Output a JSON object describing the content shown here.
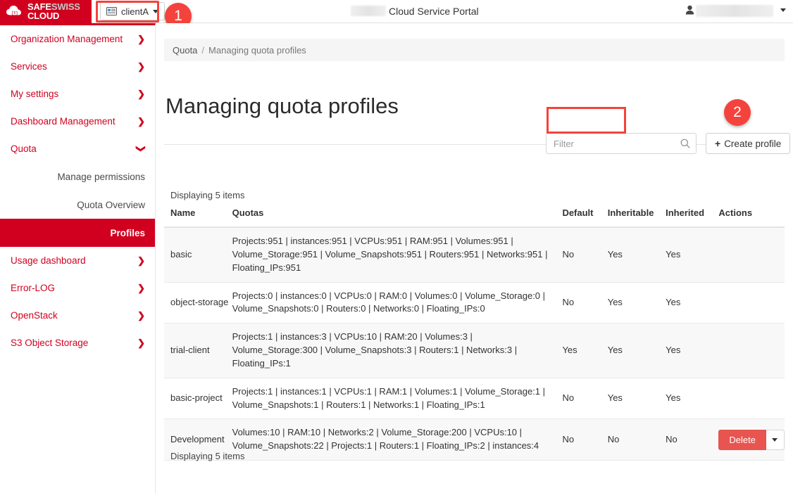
{
  "topbar": {
    "logo_line1_a": "SAFE",
    "logo_line1_b": "SWISS",
    "logo_line2": "CLOUD",
    "client_selector": "clientA",
    "portal_title": "Cloud Service Portal",
    "brand_color": "#d1001f",
    "annotation_color": "#f4433c"
  },
  "annotations": [
    {
      "number": "1",
      "target": "client-selector"
    },
    {
      "number": "2",
      "target": "create-profile-button"
    }
  ],
  "sidebar": {
    "items": [
      {
        "label": "Organization Management",
        "icon": "chevron-right-icon",
        "expanded": false
      },
      {
        "label": "Services",
        "icon": "chevron-right-icon",
        "expanded": false
      },
      {
        "label": "My settings",
        "icon": "chevron-right-icon",
        "expanded": false
      },
      {
        "label": "Dashboard Management",
        "icon": "chevron-right-icon",
        "expanded": false
      },
      {
        "label": "Quota",
        "icon": "chevron-down-icon",
        "expanded": true
      }
    ],
    "quota_subitems": [
      {
        "label": "Manage permissions",
        "active": false
      },
      {
        "label": "Quota Overview",
        "active": false
      },
      {
        "label": "Profiles",
        "active": true
      }
    ],
    "items_after": [
      {
        "label": "Usage dashboard",
        "icon": "chevron-right-icon"
      },
      {
        "label": "Error-LOG",
        "icon": "chevron-right-icon"
      },
      {
        "label": "OpenStack",
        "icon": "chevron-right-icon"
      },
      {
        "label": "S3 Object Storage",
        "icon": "chevron-right-icon"
      }
    ]
  },
  "main": {
    "breadcrumb": {
      "parent": "Quota",
      "separator": "/",
      "current": "Managing quota profiles"
    },
    "page_title": "Managing quota profiles",
    "filter_placeholder": "Filter",
    "filter_value": "",
    "create_button": "Create profile",
    "count_top": "Displaying 5 items",
    "count_bottom": "Displaying 5 items",
    "table": {
      "headers": [
        "Name",
        "Quotas",
        "Default",
        "Inheritable",
        "Inherited",
        "Actions"
      ],
      "rows": [
        {
          "name": "basic",
          "quotas": "Projects:951 | instances:951 | VCPUs:951 | RAM:951 | Volumes:951 | Volume_Storage:951 | Volume_Snapshots:951 | Routers:951 | Networks:951 | Floating_IPs:951",
          "default": "No",
          "inheritable": "Yes",
          "inherited": "Yes",
          "action": ""
        },
        {
          "name": "object-storage",
          "quotas": "Projects:0 | instances:0 | VCPUs:0 | RAM:0 | Volumes:0 | Volume_Storage:0 | Volume_Snapshots:0 | Routers:0 | Networks:0 | Floating_IPs:0",
          "default": "No",
          "inheritable": "Yes",
          "inherited": "Yes",
          "action": ""
        },
        {
          "name": "trial-client",
          "quotas": "Projects:1 | instances:3 | VCPUs:10 | RAM:20 | Volumes:3 | Volume_Storage:300 | Volume_Snapshots:3 | Routers:1 | Networks:3 | Floating_IPs:1",
          "default": "Yes",
          "inheritable": "Yes",
          "inherited": "Yes",
          "action": ""
        },
        {
          "name": "basic-project",
          "quotas": "Projects:1 | instances:1 | VCPUs:1 | RAM:1 | Volumes:1 | Volume_Storage:1 | Volume_Snapshots:1 | Routers:1 | Networks:1 | Floating_IPs:1",
          "default": "No",
          "inheritable": "Yes",
          "inherited": "Yes",
          "action": ""
        },
        {
          "name": "Development",
          "quotas": "Volumes:10 | RAM:10 | Networks:2 | Volume_Storage:200 | VCPUs:10 | Volume_Snapshots:22 | Projects:1 | Routers:1 | Floating_IPs:2 | instances:4",
          "default": "No",
          "inheritable": "No",
          "inherited": "No",
          "action": "Delete"
        }
      ]
    }
  }
}
